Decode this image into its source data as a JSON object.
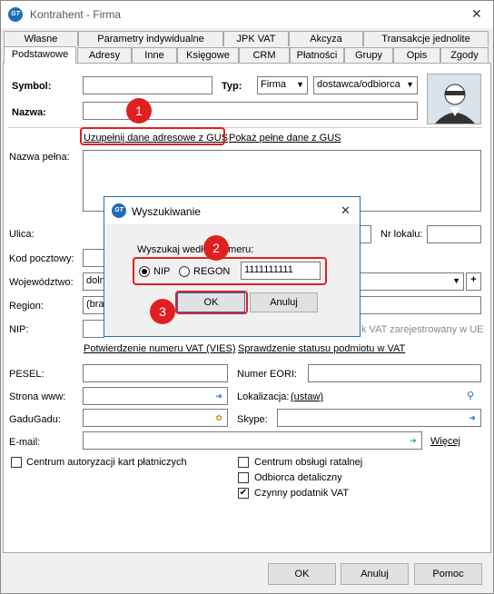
{
  "window": {
    "title": "Kontrahent - Firma",
    "close": "✕"
  },
  "tabs_row1": [
    "Własne",
    "Parametry indywidualne",
    "JPK VAT",
    "Akcyza",
    "Transakcje jednolite"
  ],
  "tabs_row2": [
    "Podstawowe",
    "Adresy",
    "Inne",
    "Księgowe",
    "CRM",
    "Płatności",
    "Grupy",
    "Opis",
    "Zgody"
  ],
  "form": {
    "symbol_label": "Symbol:",
    "typ_label": "Typ:",
    "typ_value": "Firma",
    "typ2_value": "dostawca/odbiorca",
    "nazwa_label": "Nazwa:",
    "gus_link": "Uzupełnij dane adresowe z GUS",
    "gus_full_link": "Pokaż pełne dane z GUS",
    "nazwa_pelna_label": "Nazwa pełna:",
    "ulica_label": "Ulica:",
    "nr_lokalu_label": "Nr lokalu:",
    "kod_label": "Kod pocztowy:",
    "woj_label": "Województwo:",
    "woj_value": "doln",
    "region_label": "Region:",
    "region_value": "(bra",
    "nip_label": "NIP:",
    "vat_ue_text": "k VAT zarejestrowany w UE",
    "vies_link": "Potwierdzenie numeru VAT (VIES)",
    "vat_status_link": "Sprawdzenie statusu podmiotu w VAT",
    "pesel_label": "PESEL:",
    "eori_label": "Numer EORI:",
    "www_label": "Strona www:",
    "lokalizacja_label": "Lokalizacja:",
    "ustaw_link": "(ustaw)",
    "gadu_label": "GaduGadu:",
    "skype_label": "Skype:",
    "email_label": "E-mail:",
    "wiecej_link": "Więcej",
    "cb_centrum_auto": "Centrum autoryzacji kart płatniczych",
    "cb_centrum_ratalnej": "Centrum obsługi ratalnej",
    "cb_odbiorca": "Odbiorca detaliczny",
    "cb_czynny": "Czynny podatnik VAT",
    "plus": "+"
  },
  "buttons": {
    "ok": "OK",
    "anuluj": "Anuluj",
    "pomoc": "Pomoc"
  },
  "dialog": {
    "title": "Wyszukiwanie",
    "close": "✕",
    "group_label": "Wyszukaj według numeru:",
    "radio_nip": "NIP",
    "radio_regon": "REGON",
    "number_value": "1111111111",
    "ok": "OK",
    "anuluj": "Anuluj"
  },
  "badges": {
    "b1": "1",
    "b2": "2",
    "b3": "3"
  },
  "logo_text": "GT",
  "colors": {
    "accent": "#1e6fb8",
    "annotation": "#e02020"
  }
}
